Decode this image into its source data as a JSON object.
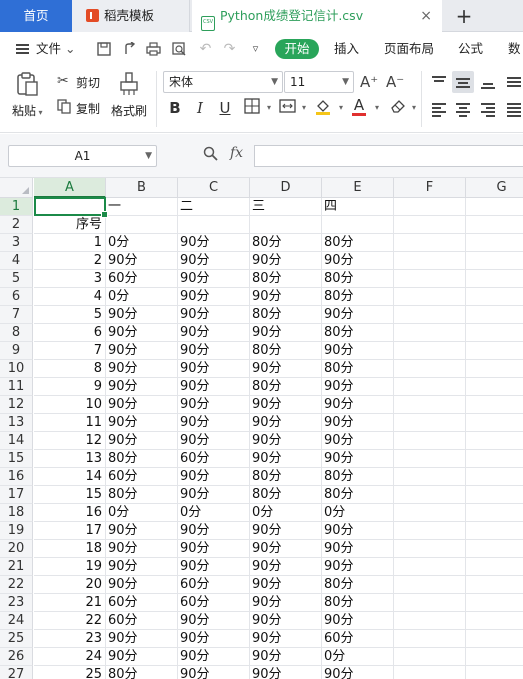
{
  "tabs": {
    "home": "首页",
    "docer": "稻壳模板",
    "file": "Python成绩登记信计.csv",
    "close_icon": "×",
    "add_icon": "+"
  },
  "menu": {
    "file": "文件",
    "file_caret": "⌄",
    "start": "开始",
    "insert": "插入",
    "page_layout": "页面布局",
    "formula": "公式",
    "data": "数据"
  },
  "ribbon": {
    "paste": "粘贴",
    "cut": "剪切",
    "copy": "复制",
    "format_painter": "格式刷",
    "font_name": "宋体",
    "font_size": "11",
    "grow_font": "A⁺",
    "shrink_font": "A⁻",
    "bold": "B",
    "italic": "I",
    "underline": "U",
    "font_color_glyph": "A",
    "fill_color": "#f5c518",
    "font_color": "#e0302f"
  },
  "formula_bar": {
    "name_box": "A1",
    "fx": "fx",
    "formula_value": ""
  },
  "sheet": {
    "columns": [
      "A",
      "B",
      "C",
      "D",
      "E",
      "F",
      "G"
    ],
    "active_column": "A",
    "active_row": "1",
    "row_numbers": [
      "1",
      "2",
      "3",
      "4",
      "5",
      "6",
      "7",
      "8",
      "9",
      "10",
      "11",
      "12",
      "13",
      "14",
      "15",
      "16",
      "17",
      "18",
      "19",
      "20",
      "21",
      "22",
      "23",
      "24",
      "25",
      "26",
      "27"
    ],
    "rows": [
      [
        "",
        "一",
        "二",
        "三",
        "四"
      ],
      [
        "序号",
        "",
        "",
        "",
        ""
      ],
      [
        "1",
        "0分",
        "90分",
        "80分",
        "80分"
      ],
      [
        "2",
        "90分",
        "90分",
        "90分",
        "90分"
      ],
      [
        "3",
        "60分",
        "90分",
        "80分",
        "80分"
      ],
      [
        "4",
        "0分",
        "90分",
        "90分",
        "80分"
      ],
      [
        "5",
        "90分",
        "90分",
        "80分",
        "90分"
      ],
      [
        "6",
        "90分",
        "90分",
        "90分",
        "80分"
      ],
      [
        "7",
        "90分",
        "90分",
        "80分",
        "90分"
      ],
      [
        "8",
        "90分",
        "90分",
        "90分",
        "80分"
      ],
      [
        "9",
        "90分",
        "90分",
        "80分",
        "90分"
      ],
      [
        "10",
        "90分",
        "90分",
        "90分",
        "90分"
      ],
      [
        "11",
        "90分",
        "90分",
        "90分",
        "90分"
      ],
      [
        "12",
        "90分",
        "90分",
        "90分",
        "90分"
      ],
      [
        "13",
        "80分",
        "60分",
        "90分",
        "90分"
      ],
      [
        "14",
        "60分",
        "90分",
        "80分",
        "80分"
      ],
      [
        "15",
        "80分",
        "90分",
        "80分",
        "80分"
      ],
      [
        "16",
        "0分",
        "0分",
        "0分",
        "0分"
      ],
      [
        "17",
        "90分",
        "90分",
        "90分",
        "90分"
      ],
      [
        "18",
        "90分",
        "90分",
        "90分",
        "90分"
      ],
      [
        "19",
        "90分",
        "90分",
        "90分",
        "90分"
      ],
      [
        "20",
        "90分",
        "60分",
        "90分",
        "80分"
      ],
      [
        "21",
        "60分",
        "60分",
        "90分",
        "80分"
      ],
      [
        "22",
        "60分",
        "90分",
        "90分",
        "90分"
      ],
      [
        "23",
        "90分",
        "90分",
        "90分",
        "60分"
      ],
      [
        "24",
        "90分",
        "90分",
        "90分",
        "0分"
      ],
      [
        "25",
        "80分",
        "90分",
        "90分",
        "90分"
      ]
    ]
  }
}
